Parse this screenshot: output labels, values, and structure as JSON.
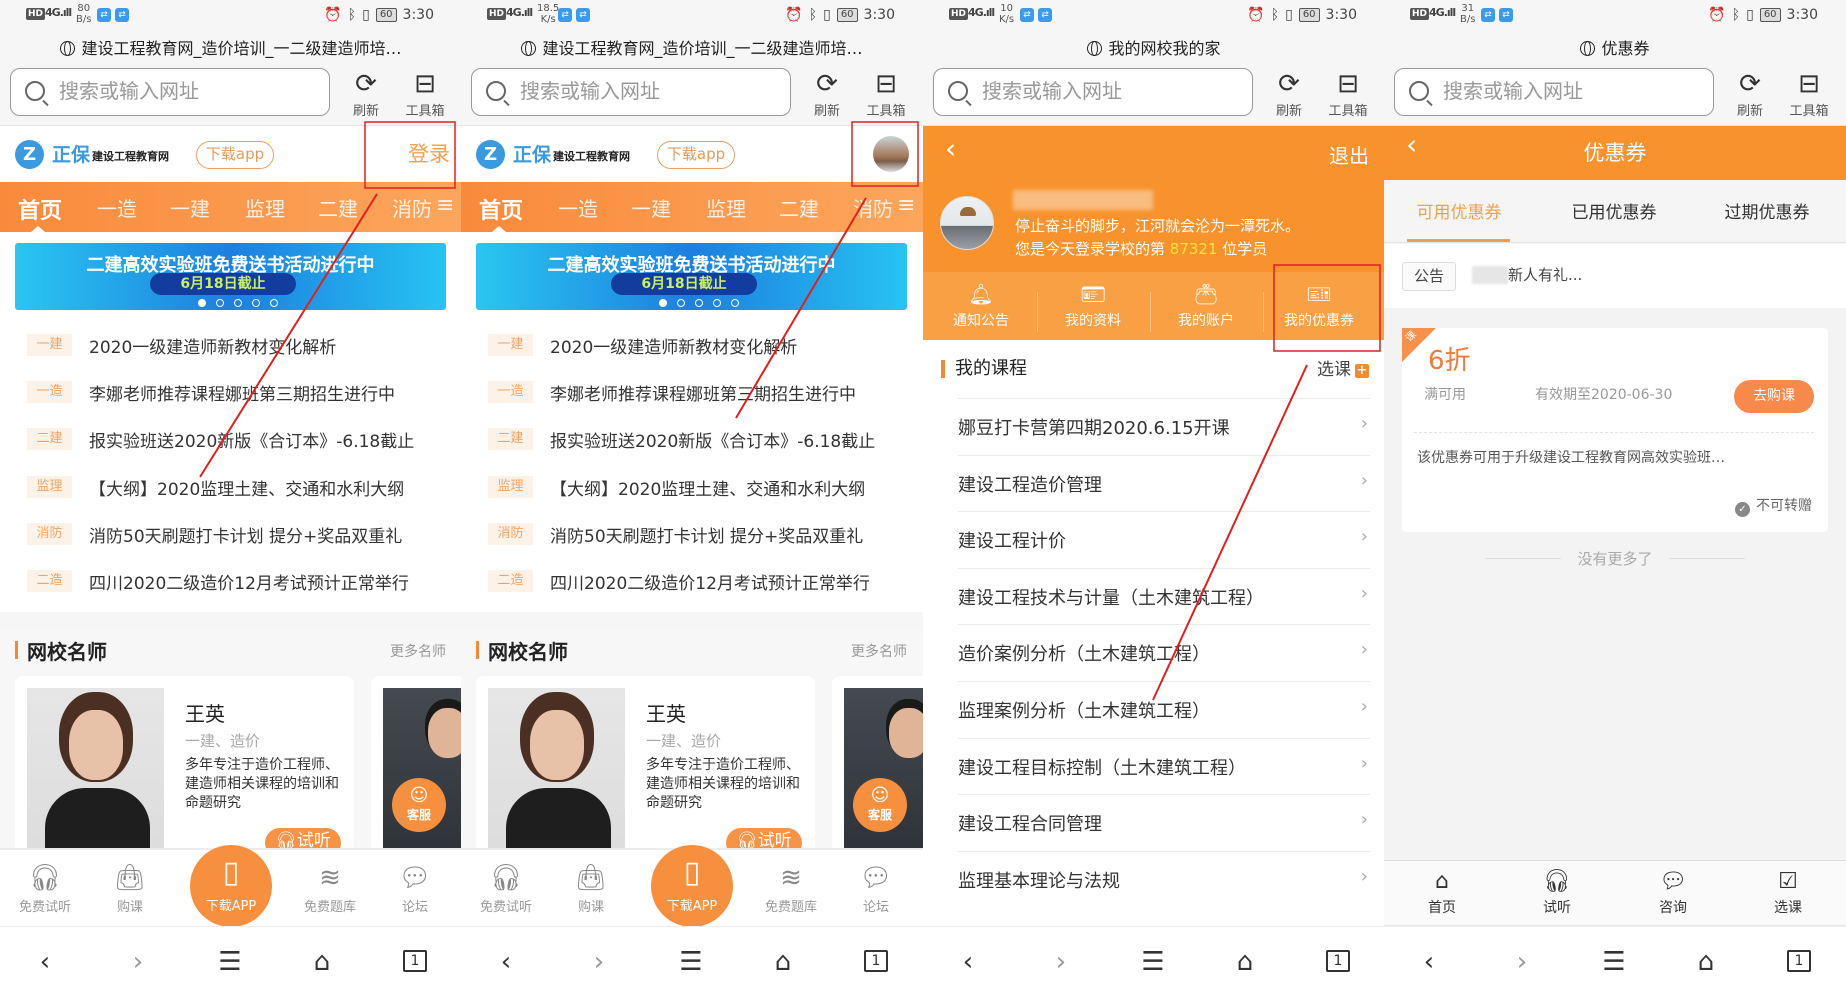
{
  "chrome": [
    {
      "speed": "80",
      "speed_unit": "B/s",
      "page_title": "建设工程教育网_造价培训_一二级建造师培…"
    },
    {
      "speed": "18.5",
      "speed_unit": "K/s",
      "page_title": "建设工程教育网_造价培训_一二级建造师培…"
    },
    {
      "speed": "10",
      "speed_unit": "K/s",
      "page_title": "我的网校我的家"
    },
    {
      "speed": "31",
      "speed_unit": "B/s",
      "page_title": "优惠券"
    }
  ],
  "status": {
    "hd": "HD",
    "signal": "4G",
    "battery": "60",
    "time": "3:30"
  },
  "browser": {
    "search_placeholder": "搜索或输入网址",
    "refresh": "刷新",
    "toolbox": "工具箱",
    "tab_count": "1"
  },
  "home": {
    "logo_brand": "正保",
    "logo_name": "建设工程教育网",
    "download_app": "下载app",
    "login": "登录",
    "nav": [
      "首页",
      "一造",
      "一建",
      "监理",
      "二建",
      "消防"
    ],
    "banner": {
      "title": "二建高效实验班免费送书活动进行中",
      "deadline": "6月18日截止",
      "slides": 5,
      "active_slide": 1
    },
    "news": [
      {
        "tag": "一建",
        "title": "2020一级建造师新教材变化解析"
      },
      {
        "tag": "一造",
        "title": "李娜老师推荐课程娜班第三期招生进行中"
      },
      {
        "tag": "二建",
        "title": "报实验班送2020新版《合订本》-6.18截止"
      },
      {
        "tag": "监理",
        "title": "【大纲】2020监理土建、交通和水利大纲"
      },
      {
        "tag": "消防",
        "title": "消防50天刷题打卡计划 提分+奖品双重礼"
      },
      {
        "tag": "二造",
        "title": "四川2020二级造价12月考试预计正常举行"
      }
    ],
    "teachers_title": "网校名师",
    "more_teachers": "更多名师",
    "teacher": {
      "name": "王英",
      "subjects": "一建、造价",
      "desc": "多年专注于造价工程师、建造师相关课程的培训和命题研究",
      "listen": "试听"
    },
    "service": "客服",
    "tabs": [
      "免费试听",
      "购课",
      "下载APP",
      "免费题库",
      "论坛"
    ]
  },
  "profile": {
    "logout": "退出",
    "motto": "停止奋斗的脚步，江河就会沦为一潭死水。",
    "login_rank_prefix": "您是今天登录学校的第",
    "login_rank": "87321",
    "login_rank_suffix": "位学员",
    "menu": [
      "通知公告",
      "我的资料",
      "我的账户",
      "我的优惠券"
    ],
    "courses_title": "我的课程",
    "pick_course": "选课",
    "courses": [
      "娜豆打卡营第四期2020.6.15开课",
      "建设工程造价管理",
      "建设工程计价",
      "建设工程技术与计量（土木建筑工程）",
      "造价案例分析（土木建筑工程）",
      "监理案例分析（土木建筑工程）",
      "建设工程目标控制（土木建筑工程）",
      "建设工程合同管理",
      "监理基本理论与法规"
    ]
  },
  "coupons": {
    "title": "优惠券",
    "tabs": [
      "可用优惠券",
      "已用优惠券",
      "过期优惠券"
    ],
    "active_tab": 0,
    "notice_tag": "公告",
    "notice_text": "新人有礼...",
    "coupon": {
      "corner": "课",
      "discount": "6折",
      "condition": "满可用",
      "validity": "有效期至2020-06-30",
      "buy": "去购课",
      "desc": "该优惠券可用于升级建设工程教育网高效实验班…",
      "transfer": "不可转赠"
    },
    "no_more": "没有更多了",
    "tabs_bottom": [
      "首页",
      "试听",
      "咨询",
      "选课"
    ]
  },
  "colors": {
    "accent": "#f7922c",
    "annotation": "#e02020",
    "link_blue": "#3a9ae0"
  }
}
